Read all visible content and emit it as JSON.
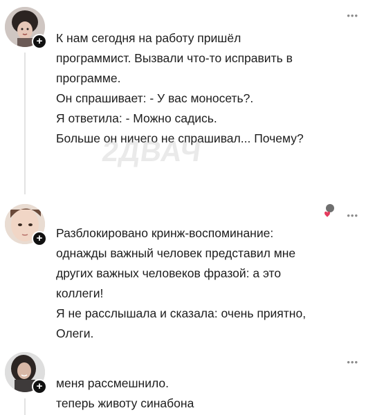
{
  "watermark": "2ДВАЧ",
  "icons": {
    "more": "more-options-icon",
    "follow": "plus-icon",
    "author_liked": "heart-icon"
  },
  "colors": {
    "text": "#1d1d1d",
    "badge": "#111111",
    "muted": "#8a8a8a",
    "heart": "#e53a5d"
  },
  "posts": [
    {
      "more_label": "•••",
      "badge_label": "+",
      "lines": [
        "К нам сегодня на работу пришёл",
        "программист. Вызвали что-то исправить в",
        "программе.",
        "Он спрашивает: - У вас моносеть?.",
        "Я ответила: - Можно садись.",
        "Больше он ничего не спрашивал... Почему?"
      ]
    },
    {
      "more_label": "•••",
      "badge_label": "+",
      "lines": [
        "Разблокировано кринж-воспоминание:",
        "однажды важный человек представил мне",
        "других важных человеков фразой: а это",
        "коллеги!",
        "Я не расслышала и сказала: очень приятно,",
        "Олеги."
      ]
    },
    {
      "more_label": "•••",
      "badge_label": "+",
      "lines": [
        "меня рассмешнило.",
        "теперь животу синабона"
      ]
    }
  ]
}
